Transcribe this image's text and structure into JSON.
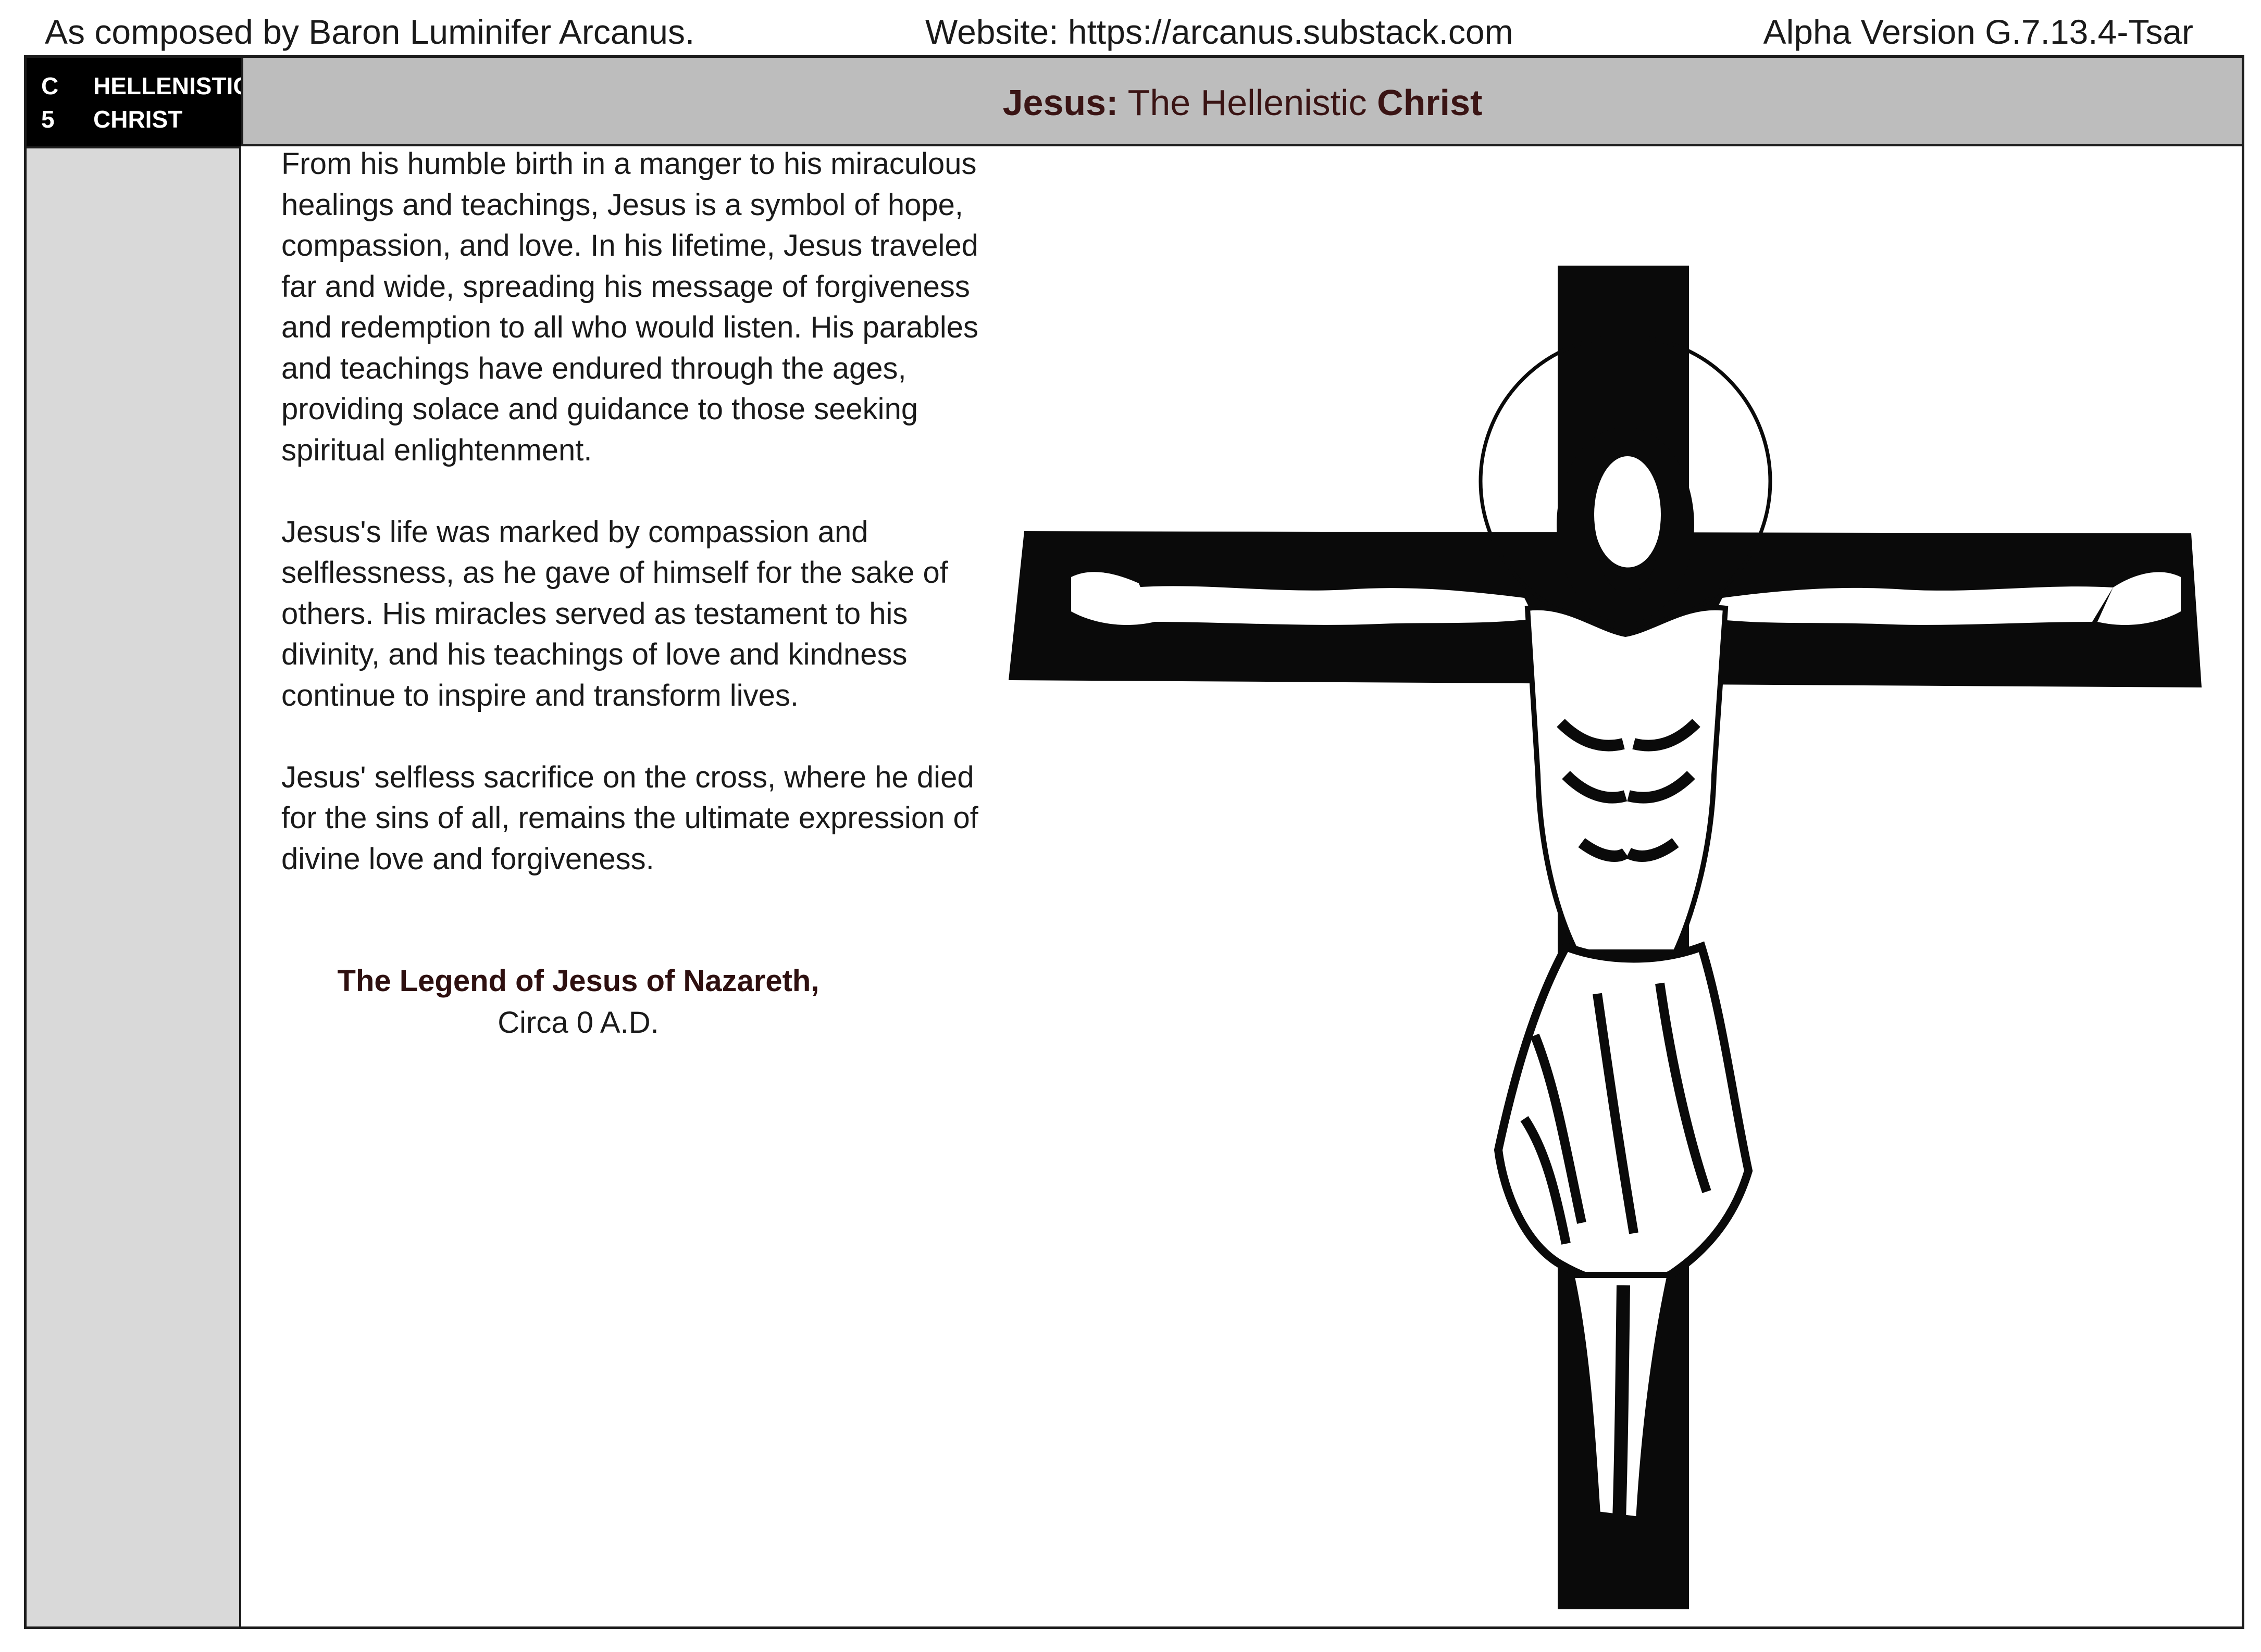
{
  "header": {
    "author": "As composed by Baron Luminifer Arcanus.",
    "website": "Website: https://arcanus.substack.com",
    "version": "Alpha Version G.7.13.4-Tsar"
  },
  "chapter": {
    "number_lines": [
      "C",
      "5"
    ],
    "name_lines": [
      "HELLENISTIC",
      "CHRIST"
    ]
  },
  "title": {
    "bold_start": "Jesus:",
    "middle": " The Hellenistic ",
    "bold_end": "Christ"
  },
  "paragraphs": [
    "From his humble birth in a manger to his miraculous healings and teachings, Jesus is a symbol of hope, compassion, and love. In his lifetime, Jesus traveled far and wide, spreading his message of forgiveness and redemption to all who would listen. His parables and teachings have endured through the ages, providing solace and guidance to those seeking spiritual enlightenment.",
    "Jesus's life was marked by compassion and selflessness, as he gave of himself for the sake of others. His miracles served as testament to his divinity, and his teachings of love and kindness continue to inspire and transform lives.",
    "Jesus' selfless sacrifice on the cross, where he died for the sins of all, remains the ultimate expression of divine love and forgiveness."
  ],
  "citation": {
    "source": "The Legend of Jesus of Nazareth,",
    "date": "Circa 0 A.D."
  },
  "illustration": {
    "subject": "crucifix-icon",
    "colors": {
      "ink": "#0a0a0a",
      "paper": "#ffffff"
    }
  },
  "colors": {
    "title_bar": "#bdbdbd",
    "sidebar": "#d9d9d9",
    "chapter_box": "#000000",
    "title_text": "#3a1414"
  }
}
